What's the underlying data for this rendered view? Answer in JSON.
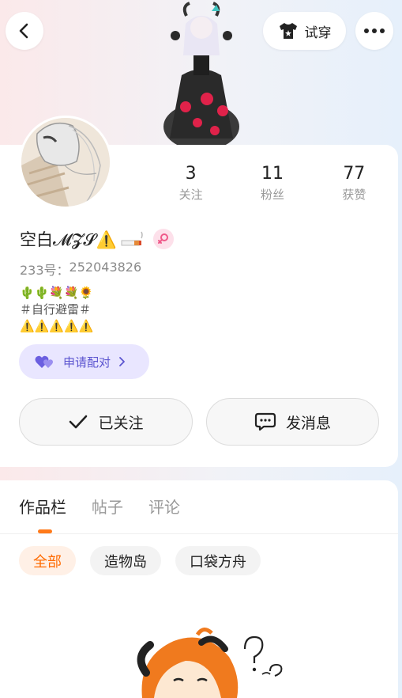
{
  "header": {
    "try_on_label": "试穿"
  },
  "stats": [
    {
      "value": "3",
      "label": "关注"
    },
    {
      "value": "11",
      "label": "粉丝"
    },
    {
      "value": "77",
      "label": "获赞"
    }
  ],
  "profile": {
    "username": "空白𝓜𝓩𝓢⚠️",
    "uid_label": "233号：",
    "uid_value": "252043826",
    "bio_line1": "🌵🌵💐💐🌻",
    "bio_line2": "＃自行避雷＃",
    "bio_line3": "⚠️⚠️⚠️⚠️⚠️",
    "gender_icon": "female-icon"
  },
  "pair": {
    "label": "申请配对"
  },
  "actions": {
    "follow_label": "已关注",
    "message_label": "发消息"
  },
  "tabs": [
    {
      "label": "作品栏",
      "active": true
    },
    {
      "label": "帖子",
      "active": false
    },
    {
      "label": "评论",
      "active": false
    }
  ],
  "chips": [
    {
      "label": "全部",
      "active": true
    },
    {
      "label": "造物岛",
      "active": false
    },
    {
      "label": "口袋方舟",
      "active": false
    }
  ],
  "colors": {
    "accent": "#ff7a1a",
    "pair_bg": "#e9e6ff",
    "pair_text": "#5c55d0"
  }
}
